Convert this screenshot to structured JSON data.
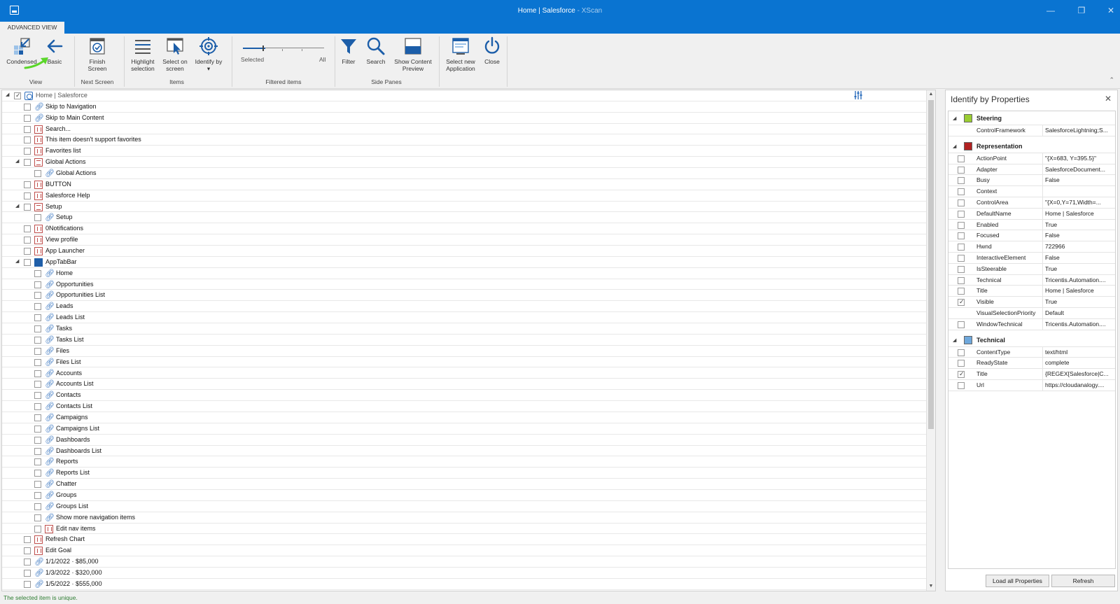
{
  "window": {
    "title": "Home | Salesforce",
    "app_suffix": " - XScan",
    "controls": [
      "minimize-icon",
      "restore-icon",
      "close-icon"
    ]
  },
  "tabs": [
    {
      "label": "ADVANCED VIEW"
    }
  ],
  "ribbon": {
    "view_group": "View",
    "condensed": "Condensed",
    "basic": "Basic",
    "next_group": "Next Screen",
    "finish_1": "Finish",
    "finish_2": "Screen",
    "items_group": "Items",
    "highlight_1": "Highlight",
    "highlight_2": "selection",
    "select_1": "Select on",
    "select_2": "screen",
    "identify": "Identify by",
    "filtered_group": "Filtered items",
    "slider_selected": "Selected",
    "slider_all": "All",
    "side_group": "Side Panes",
    "filter": "Filter",
    "search": "Search",
    "preview_1": "Show Content",
    "preview_2": "Preview",
    "newapp_1": "Select new",
    "newapp_2": "Application",
    "close": "Close",
    "accent": "#1c5ea9",
    "annotation_arrow_color": "#5bd62a"
  },
  "tree": {
    "rows": [
      {
        "label": "Home | Salesforce",
        "level": 0,
        "icon": "page-icon",
        "expand": "open",
        "checked": true
      },
      {
        "label": "Skip to Navigation",
        "level": 1,
        "icon": "link-icon"
      },
      {
        "label": "Skip to Main Content",
        "level": 1,
        "icon": "link-icon"
      },
      {
        "label": "Search...",
        "level": 1,
        "icon": "button-icon"
      },
      {
        "label": "This item doesn't support favorites",
        "level": 1,
        "icon": "button-icon"
      },
      {
        "label": "Favorites list",
        "level": 1,
        "icon": "button-icon"
      },
      {
        "label": "Global Actions",
        "level": 1,
        "icon": "group-icon",
        "expand": "open"
      },
      {
        "label": "Global Actions",
        "level": 2,
        "icon": "link-icon"
      },
      {
        "label": "BUTTON",
        "level": 1,
        "icon": "button-icon"
      },
      {
        "label": "Salesforce Help",
        "level": 1,
        "icon": "button-icon"
      },
      {
        "label": "Setup",
        "level": 1,
        "icon": "group-icon",
        "expand": "open"
      },
      {
        "label": "Setup",
        "level": 2,
        "icon": "link-icon"
      },
      {
        "label": "0Notifications",
        "level": 1,
        "icon": "button-icon"
      },
      {
        "label": "View profile",
        "level": 1,
        "icon": "button-icon"
      },
      {
        "label": "App Launcher",
        "level": 1,
        "icon": "button-icon"
      },
      {
        "label": "AppTabBar",
        "level": 1,
        "icon": "tabbar-icon",
        "expand": "open"
      },
      {
        "label": "Home",
        "level": 2,
        "icon": "link-icon"
      },
      {
        "label": "Opportunities",
        "level": 2,
        "icon": "link-icon"
      },
      {
        "label": "Opportunities List",
        "level": 2,
        "icon": "link-icon"
      },
      {
        "label": "Leads",
        "level": 2,
        "icon": "link-icon"
      },
      {
        "label": "Leads List",
        "level": 2,
        "icon": "link-icon"
      },
      {
        "label": "Tasks",
        "level": 2,
        "icon": "link-icon"
      },
      {
        "label": "Tasks List",
        "level": 2,
        "icon": "link-icon"
      },
      {
        "label": "Files",
        "level": 2,
        "icon": "link-icon"
      },
      {
        "label": "Files List",
        "level": 2,
        "icon": "link-icon"
      },
      {
        "label": "Accounts",
        "level": 2,
        "icon": "link-icon"
      },
      {
        "label": "Accounts List",
        "level": 2,
        "icon": "link-icon"
      },
      {
        "label": "Contacts",
        "level": 2,
        "icon": "link-icon"
      },
      {
        "label": "Contacts List",
        "level": 2,
        "icon": "link-icon"
      },
      {
        "label": "Campaigns",
        "level": 2,
        "icon": "link-icon"
      },
      {
        "label": "Campaigns List",
        "level": 2,
        "icon": "link-icon"
      },
      {
        "label": "Dashboards",
        "level": 2,
        "icon": "link-icon"
      },
      {
        "label": "Dashboards List",
        "level": 2,
        "icon": "link-icon"
      },
      {
        "label": "Reports",
        "level": 2,
        "icon": "link-icon"
      },
      {
        "label": "Reports List",
        "level": 2,
        "icon": "link-icon"
      },
      {
        "label": "Chatter",
        "level": 2,
        "icon": "link-icon"
      },
      {
        "label": "Groups",
        "level": 2,
        "icon": "link-icon"
      },
      {
        "label": "Groups List",
        "level": 2,
        "icon": "link-icon"
      },
      {
        "label": "Show more navigation items",
        "level": 2,
        "icon": "link-icon"
      },
      {
        "label": "Edit nav items",
        "level": 2,
        "icon": "button-icon"
      },
      {
        "label": "Refresh Chart",
        "level": 1,
        "icon": "button-icon"
      },
      {
        "label": "Edit Goal",
        "level": 1,
        "icon": "button-icon"
      },
      {
        "label": "1/1/2022 · $85,000",
        "level": 1,
        "icon": "link-icon"
      },
      {
        "label": "1/3/2022 · $320,000",
        "level": 1,
        "icon": "link-icon"
      },
      {
        "label": "1/5/2022 · $555,000",
        "level": 1,
        "icon": "link-icon"
      }
    ]
  },
  "props": {
    "title": "Identify by Properties",
    "categories": [
      {
        "name": "Steering",
        "color": "#9acd32",
        "rows": [
          {
            "name": "ControlFramework",
            "value": "SalesforceLightning;S...",
            "checkbox": false
          }
        ]
      },
      {
        "name": "Representation",
        "color": "#b22222",
        "rows": [
          {
            "name": "ActionPoint",
            "value": "\"{X=683, Y=395.5}\"",
            "checkbox": true
          },
          {
            "name": "Adapter",
            "value": "SalesforceDocument...",
            "checkbox": true
          },
          {
            "name": "Busy",
            "value": "False",
            "checkbox": true
          },
          {
            "name": "Context",
            "value": "",
            "checkbox": true
          },
          {
            "name": "ControlArea",
            "value": "\"{X=0,Y=71,Width=...",
            "checkbox": true
          },
          {
            "name": "DefaultName",
            "value": "Home | Salesforce",
            "checkbox": true
          },
          {
            "name": "Enabled",
            "value": "True",
            "checkbox": true
          },
          {
            "name": "Focused",
            "value": "False",
            "checkbox": true
          },
          {
            "name": "Hwnd",
            "value": "722966",
            "checkbox": true
          },
          {
            "name": "InteractiveElement",
            "value": "False",
            "checkbox": true
          },
          {
            "name": "IsSteerable",
            "value": "True",
            "checkbox": true
          },
          {
            "name": "Technical",
            "value": "Tricentis.Automation....",
            "checkbox": true
          },
          {
            "name": "Title",
            "value": "Home | Salesforce",
            "checkbox": true
          },
          {
            "name": "Visible",
            "value": "True",
            "checkbox": true,
            "checked": true
          },
          {
            "name": "VisualSelectionPriority",
            "value": "Default",
            "checkbox": false
          },
          {
            "name": "WindowTechnical",
            "value": "Tricentis.Automation....",
            "checkbox": true
          }
        ]
      },
      {
        "name": "Technical",
        "color": "#6fa8dc",
        "rows": [
          {
            "name": "ContentType",
            "value": "text/html",
            "checkbox": true
          },
          {
            "name": "ReadyState",
            "value": "complete",
            "checkbox": true
          },
          {
            "name": "Title",
            "value": "{REGEX[Salesforce|C...",
            "checkbox": true,
            "checked": true
          },
          {
            "name": "Url",
            "value": "https://cloudanalogy....",
            "checkbox": true
          }
        ]
      }
    ],
    "load_all": "Load all Properties",
    "refresh": "Refresh"
  },
  "status": {
    "message": "The selected item is unique."
  }
}
